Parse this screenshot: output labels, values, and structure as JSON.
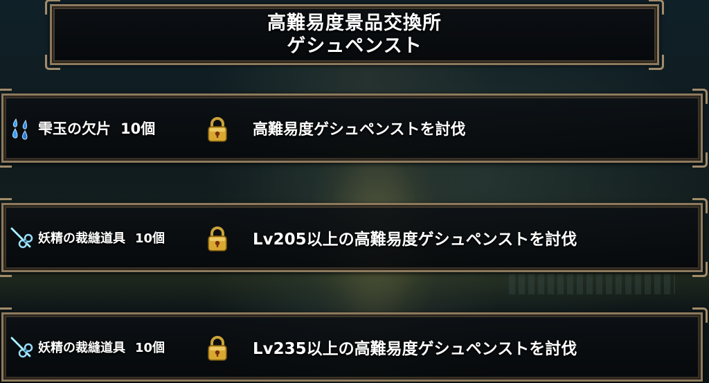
{
  "header": {
    "title_line1": "高難易度景品交換所",
    "title_line2": "ゲシュペンスト"
  },
  "rewards": [
    {
      "item_name": "雫玉の欠片",
      "count": "10個",
      "icon": "water-drops-icon",
      "locked": true,
      "condition": "高難易度ゲシュペンストを討伐"
    },
    {
      "item_name": "妖精の裁縫道具",
      "count": "10個",
      "icon": "sewing-tools-icon",
      "locked": true,
      "condition": "Lv205以上の高難易度ゲシュペンストを討伐"
    },
    {
      "item_name": "妖精の裁縫道具",
      "count": "10個",
      "icon": "sewing-tools-icon",
      "locked": true,
      "condition": "Lv235以上の高難易度ゲシュペンストを討伐"
    }
  ],
  "colors": {
    "frame": "#8d7a5e",
    "lock_gold": "#d8a830",
    "gem_blue": "#3a9cf0"
  }
}
